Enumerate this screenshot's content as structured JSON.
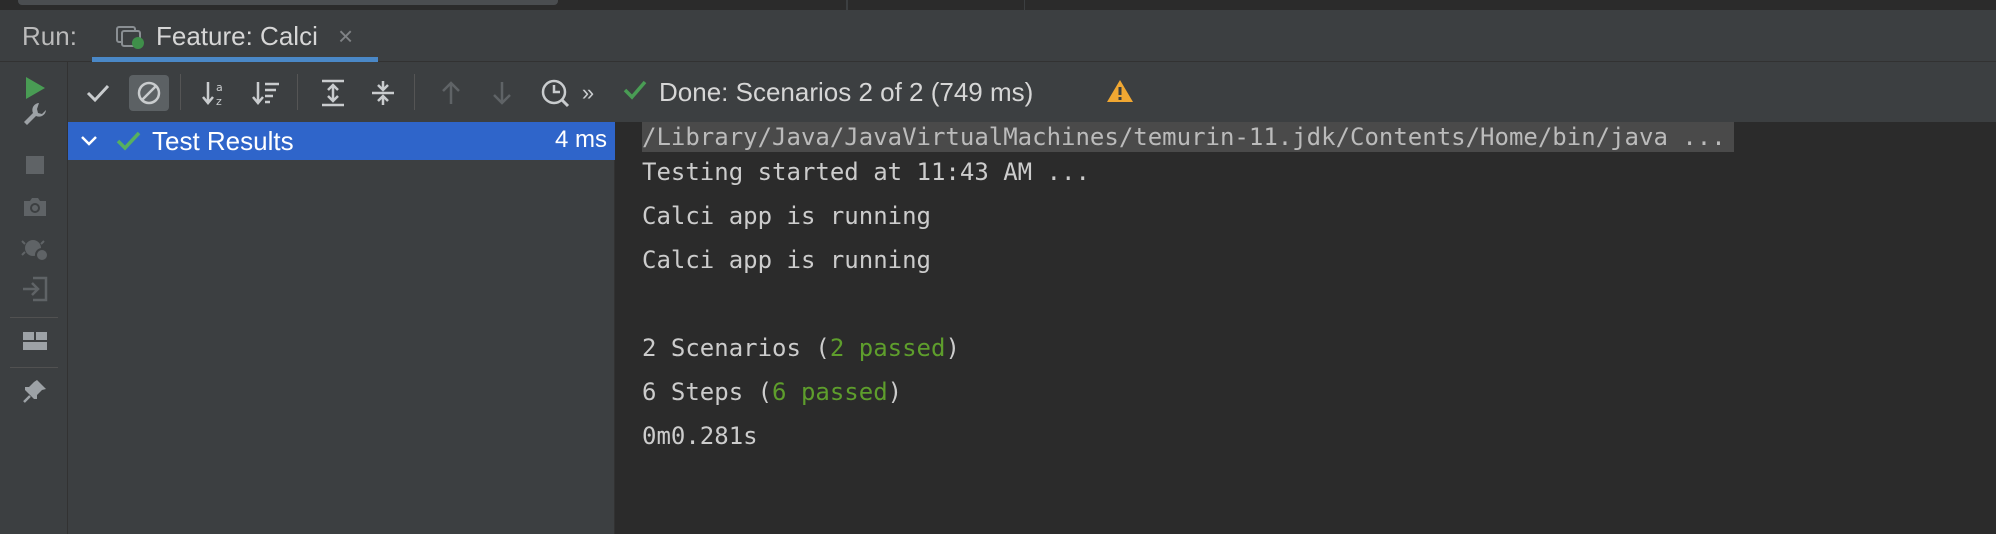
{
  "tabbar": {
    "run_label": "Run:",
    "tab_title": "Feature: Calci",
    "tab_close": "×",
    "tab_icon": "cucumber-feature-icon"
  },
  "left_toolbar": {
    "items": [
      "rerun-icon",
      "wrench-icon",
      "stop-icon",
      "camera-icon",
      "debug-exception-icon",
      "exit-icon",
      "layout-icon",
      "pin-icon"
    ]
  },
  "toolbar": {
    "items": [
      "show-passed-icon",
      "show-ignored-icon",
      "sort-alpha-icon",
      "sort-duration-icon",
      "expand-all-icon",
      "collapse-all-icon",
      "prev-failed-icon",
      "next-failed-icon",
      "test-history-icon",
      "more-chevron-icon"
    ],
    "more": "»",
    "status_text": "Done: Scenarios 2 of 2  (749 ms)",
    "warning_icon": "warning-icon"
  },
  "tree": {
    "root_label": "Test Results",
    "root_time": "4 ms"
  },
  "console": {
    "command": "/Library/Java/JavaVirtualMachines/temurin-11.jdk/Contents/Home/bin/java ...",
    "line1": "Testing started at 11:43 AM ...",
    "line2": "Calci app is running",
    "line3": "Calci app is running",
    "scen_pre": "2 Scenarios (",
    "scen_pass": "2 passed",
    "scen_post": ")",
    "steps_pre": "6 Steps (",
    "steps_pass": "6 passed",
    "steps_post": ")",
    "duration": "0m0.281s"
  },
  "colors": {
    "accent": "#4a88c7",
    "selection": "#2f65ca",
    "success": "#499c54",
    "passed_text": "#5e9e2c",
    "warning": "#f0a732"
  }
}
